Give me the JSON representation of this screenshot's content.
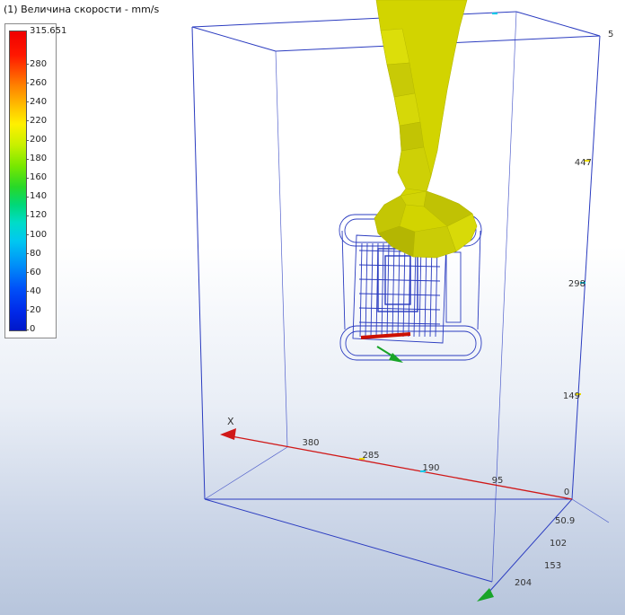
{
  "viewport": {
    "title": "(1) Величина скорости - mm/s"
  },
  "legend": {
    "max_label": "315.651",
    "max_value": 315.651,
    "ticks": [
      280,
      260,
      240,
      220,
      200,
      180,
      160,
      140,
      120,
      100,
      80,
      60,
      40,
      20,
      0
    ],
    "top_color": "#f00000",
    "bottom_color": "#0018c8"
  },
  "scene": {
    "wireframe_color": "#2b3cc0",
    "isosurface_color": "#d2d400",
    "highlight_color": "#cc1100",
    "axis_x": {
      "label": "X",
      "color": "#d01818",
      "tick_labels": [
        "380",
        "285",
        "190",
        "95"
      ]
    },
    "ruler_right": {
      "tick_labels": [
        "5",
        "447",
        "298",
        "149"
      ]
    },
    "origin_label": "0",
    "ruler_y": {
      "tick_labels": [
        "50.9",
        "102",
        "153",
        "204"
      ],
      "arrow_color": "#18a428"
    }
  }
}
